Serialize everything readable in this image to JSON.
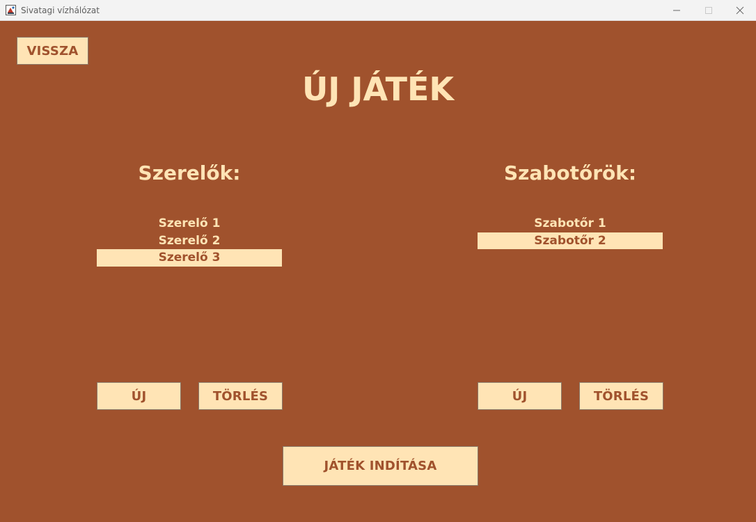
{
  "window": {
    "title": "Sivatagi vízhálózat",
    "icon": "java-app-icon",
    "controls": [
      "minimize-icon",
      "maximize-icon",
      "close-icon"
    ]
  },
  "colors": {
    "background": "#a0522d",
    "accent": "#ffe4b5",
    "titlebar": "#f3f3f3"
  },
  "back_button": "VISSZA",
  "title": "ÚJ JÁTÉK",
  "mechanics": {
    "heading": "Szerelők:",
    "items": [
      {
        "label": "Szerelő 1",
        "selected": false
      },
      {
        "label": "Szerelő 2",
        "selected": false
      },
      {
        "label": "Szerelő 3",
        "selected": true
      }
    ],
    "new_button": "ÚJ",
    "delete_button": "TÖRLÉS"
  },
  "saboteurs": {
    "heading": "Szabotőrök:",
    "items": [
      {
        "label": "Szabotőr 1",
        "selected": false
      },
      {
        "label": "Szabotőr 2",
        "selected": true
      }
    ],
    "new_button": "ÚJ",
    "delete_button": "TÖRLÉS"
  },
  "start_button": "JÁTÉK INDÍTÁSA"
}
